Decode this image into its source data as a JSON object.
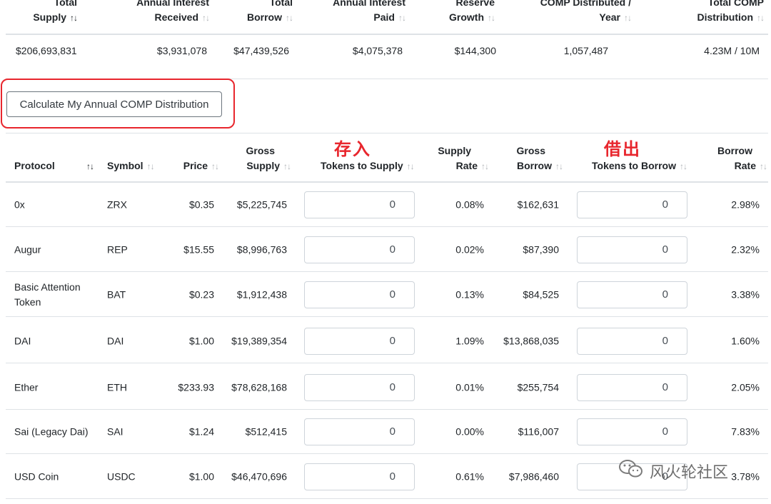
{
  "summary": {
    "headers": [
      {
        "lines": [
          "Total",
          "Supply"
        ],
        "sort": "↑↓",
        "active": true
      },
      {
        "lines": [
          "Annual Interest",
          "Received"
        ],
        "sort": "↑↓",
        "active": false
      },
      {
        "lines": [
          "Total",
          "Borrow"
        ],
        "sort": "↑↓",
        "active": false
      },
      {
        "lines": [
          "Annual Interest",
          "Paid"
        ],
        "sort": "↑↓",
        "active": false
      },
      {
        "lines": [
          "Reserve",
          "Growth"
        ],
        "sort": "↑↓",
        "active": false
      },
      {
        "lines": [
          "COMP Distributed /",
          "Year"
        ],
        "sort": "↑↓",
        "active": false
      },
      {
        "lines": [
          "Total COMP",
          "Distribution"
        ],
        "sort": "↑↓",
        "active": false
      }
    ],
    "values": [
      "$206,693,831",
      "$3,931,078",
      "$47,439,526",
      "$4,075,378",
      "$144,300",
      "1,057,487",
      "4.23M / 10M"
    ]
  },
  "calculate_button": "Calculate My Annual COMP Distribution",
  "annotations": {
    "supply": "存入",
    "borrow": "借出"
  },
  "table": {
    "headers": {
      "protocol": "Protocol",
      "symbol": "Symbol",
      "price": "Price",
      "gross_supply": [
        "Gross",
        "Supply"
      ],
      "tokens_to_supply": "Tokens to Supply",
      "supply_rate": [
        "Supply",
        "Rate"
      ],
      "gross_borrow": [
        "Gross",
        "Borrow"
      ],
      "tokens_to_borrow": "Tokens to Borrow",
      "borrow_rate": [
        "Borrow",
        "Rate"
      ],
      "sort": "↑↓"
    },
    "rows": [
      {
        "protocol": "0x",
        "symbol": "ZRX",
        "price": "$0.35",
        "gross_supply": "$5,225,745",
        "supply_input": "0",
        "supply_rate": "0.08%",
        "gross_borrow": "$162,631",
        "borrow_input": "0",
        "borrow_rate": "2.98%"
      },
      {
        "protocol": "Augur",
        "symbol": "REP",
        "price": "$15.55",
        "gross_supply": "$8,996,763",
        "supply_input": "0",
        "supply_rate": "0.02%",
        "gross_borrow": "$87,390",
        "borrow_input": "0",
        "borrow_rate": "2.32%"
      },
      {
        "protocol": "Basic Attention Token",
        "symbol": "BAT",
        "price": "$0.23",
        "gross_supply": "$1,912,438",
        "supply_input": "0",
        "supply_rate": "0.13%",
        "gross_borrow": "$84,525",
        "borrow_input": "0",
        "borrow_rate": "3.38%"
      },
      {
        "protocol": "DAI",
        "symbol": "DAI",
        "price": "$1.00",
        "gross_supply": "$19,389,354",
        "supply_input": "0",
        "supply_rate": "1.09%",
        "gross_borrow": "$13,868,035",
        "borrow_input": "0",
        "borrow_rate": "1.60%"
      },
      {
        "protocol": "Ether",
        "symbol": "ETH",
        "price": "$233.93",
        "gross_supply": "$78,628,168",
        "supply_input": "0",
        "supply_rate": "0.01%",
        "gross_borrow": "$255,754",
        "borrow_input": "0",
        "borrow_rate": "2.05%"
      },
      {
        "protocol": "Sai (Legacy Dai)",
        "symbol": "SAI",
        "price": "$1.24",
        "gross_supply": "$512,415",
        "supply_input": "0",
        "supply_rate": "0.00%",
        "gross_borrow": "$116,007",
        "borrow_input": "0",
        "borrow_rate": "7.83%"
      },
      {
        "protocol": "USD Coin",
        "symbol": "USDC",
        "price": "$1.00",
        "gross_supply": "$46,470,696",
        "supply_input": "0",
        "supply_rate": "0.61%",
        "gross_borrow": "$7,986,460",
        "borrow_input": "0",
        "borrow_rate": "3.78%"
      }
    ]
  },
  "watermark": {
    "text": "风火轮社区",
    "icon": "wechat-icon"
  },
  "colors": {
    "annotation_red": "#e8262d",
    "border": "#dee2e6",
    "text": "#212529"
  }
}
